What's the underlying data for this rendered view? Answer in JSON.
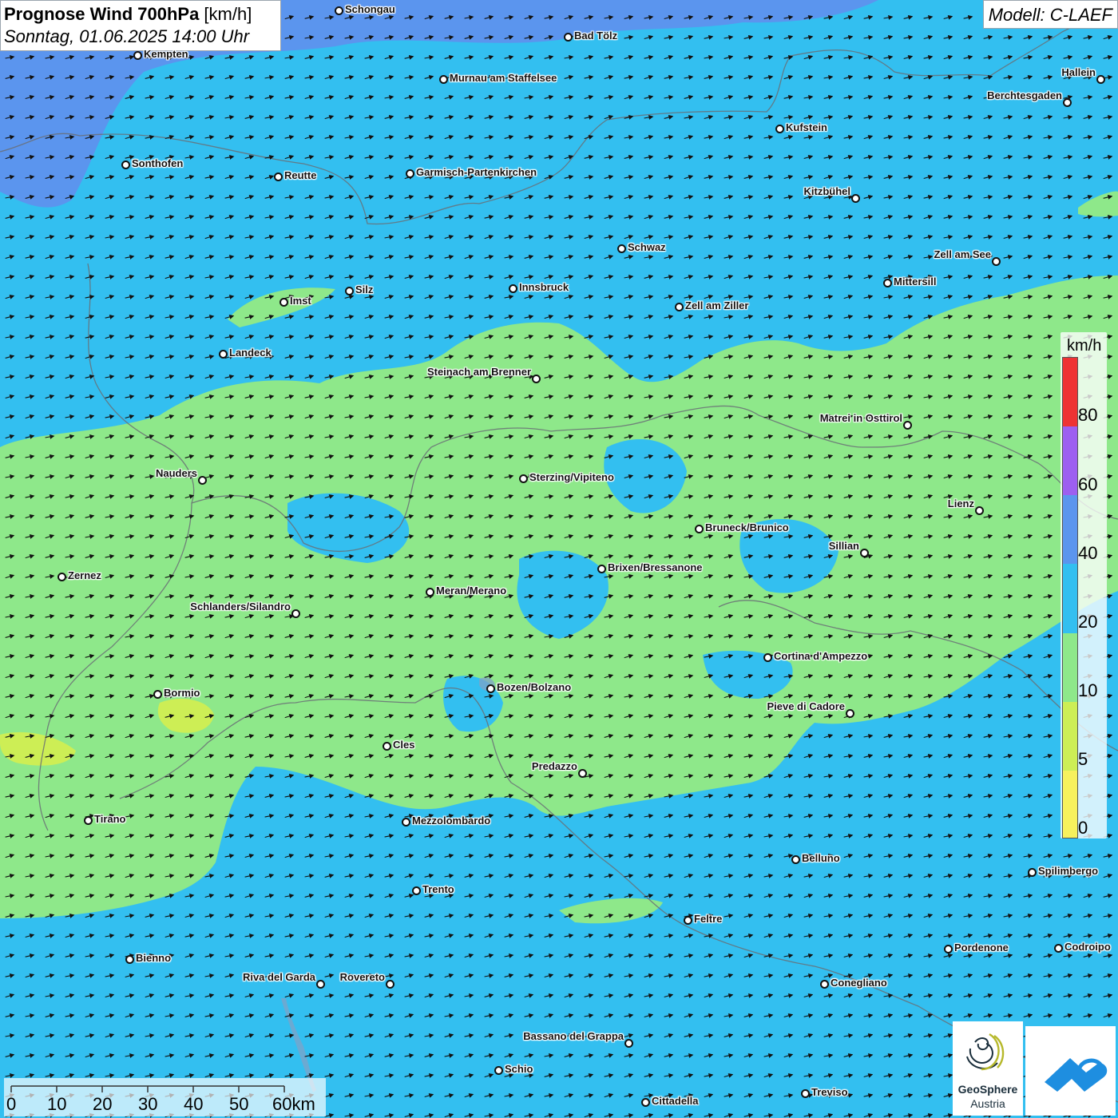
{
  "title": {
    "bold": "Prognose Wind 700hPa",
    "unit": " [km/h]",
    "date": "Sonntag, 01.06.2025 14:00 Uhr"
  },
  "model": "Modell: C-LAEF",
  "legend": {
    "unit": "km/h",
    "labels": [
      "80",
      "60",
      "40",
      "20",
      "10",
      "5",
      "0"
    ],
    "colors": [
      "#ee3333",
      "#9d5ff0",
      "#5b95ee",
      "#33bff0",
      "#8ee88a",
      "#cdee55",
      "#f7f15d"
    ]
  },
  "scalebar": {
    "labels": [
      "0",
      "10",
      "20",
      "30",
      "40",
      "50",
      "60km"
    ]
  },
  "logo": {
    "line1": "GeoSphere",
    "line2": "Austria"
  },
  "colors": {
    "wind_below_5": "#f7f15d",
    "wind_5_10": "#cdee55",
    "wind_10_20": "#8ee88a",
    "wind_20_40": "#33bff0",
    "wind_40_60": "#5b95ee",
    "wind_60_80": "#9d5ff0",
    "wind_over_80": "#ee3333"
  },
  "cities": [
    "Schongau",
    "Bad Tölz",
    "Kempten",
    "Murnau am Staffelsee",
    "Hallein",
    "Berchtesgaden",
    "Kufstein",
    "Sonthofen",
    "Reutte",
    "Garmisch-Partenkirchen",
    "Kitzbühel",
    "Schwaz",
    "Zell am See",
    "Mittersill",
    "Innsbruck",
    "Silz",
    "Imst",
    "Zell am Ziller",
    "Landeck",
    "Steinach am Brenner",
    "Matrei in Osttirol",
    "Nauders",
    "Sterzing/Vipiteno",
    "Lienz",
    "Bruneck/Brunico",
    "Sillian",
    "Brixen/Bressanone",
    "Zernez",
    "Meran/Merano",
    "Schlanders/Silandro",
    "Cortina d'Ampezzo",
    "Bozen/Bolzano",
    "Bormio",
    "Pieve di Cadore",
    "Cles",
    "Predazzo",
    "Tirano",
    "Mezzolombardo",
    "Belluno",
    "Spilimbergo",
    "Trento",
    "Feltre",
    "Pordenone",
    "Codroipo",
    "Bienno",
    "Riva del Garda",
    "Rovereto",
    "Conegliano",
    "Bassano del Grappa",
    "Schio",
    "Treviso",
    "Cittadella"
  ]
}
